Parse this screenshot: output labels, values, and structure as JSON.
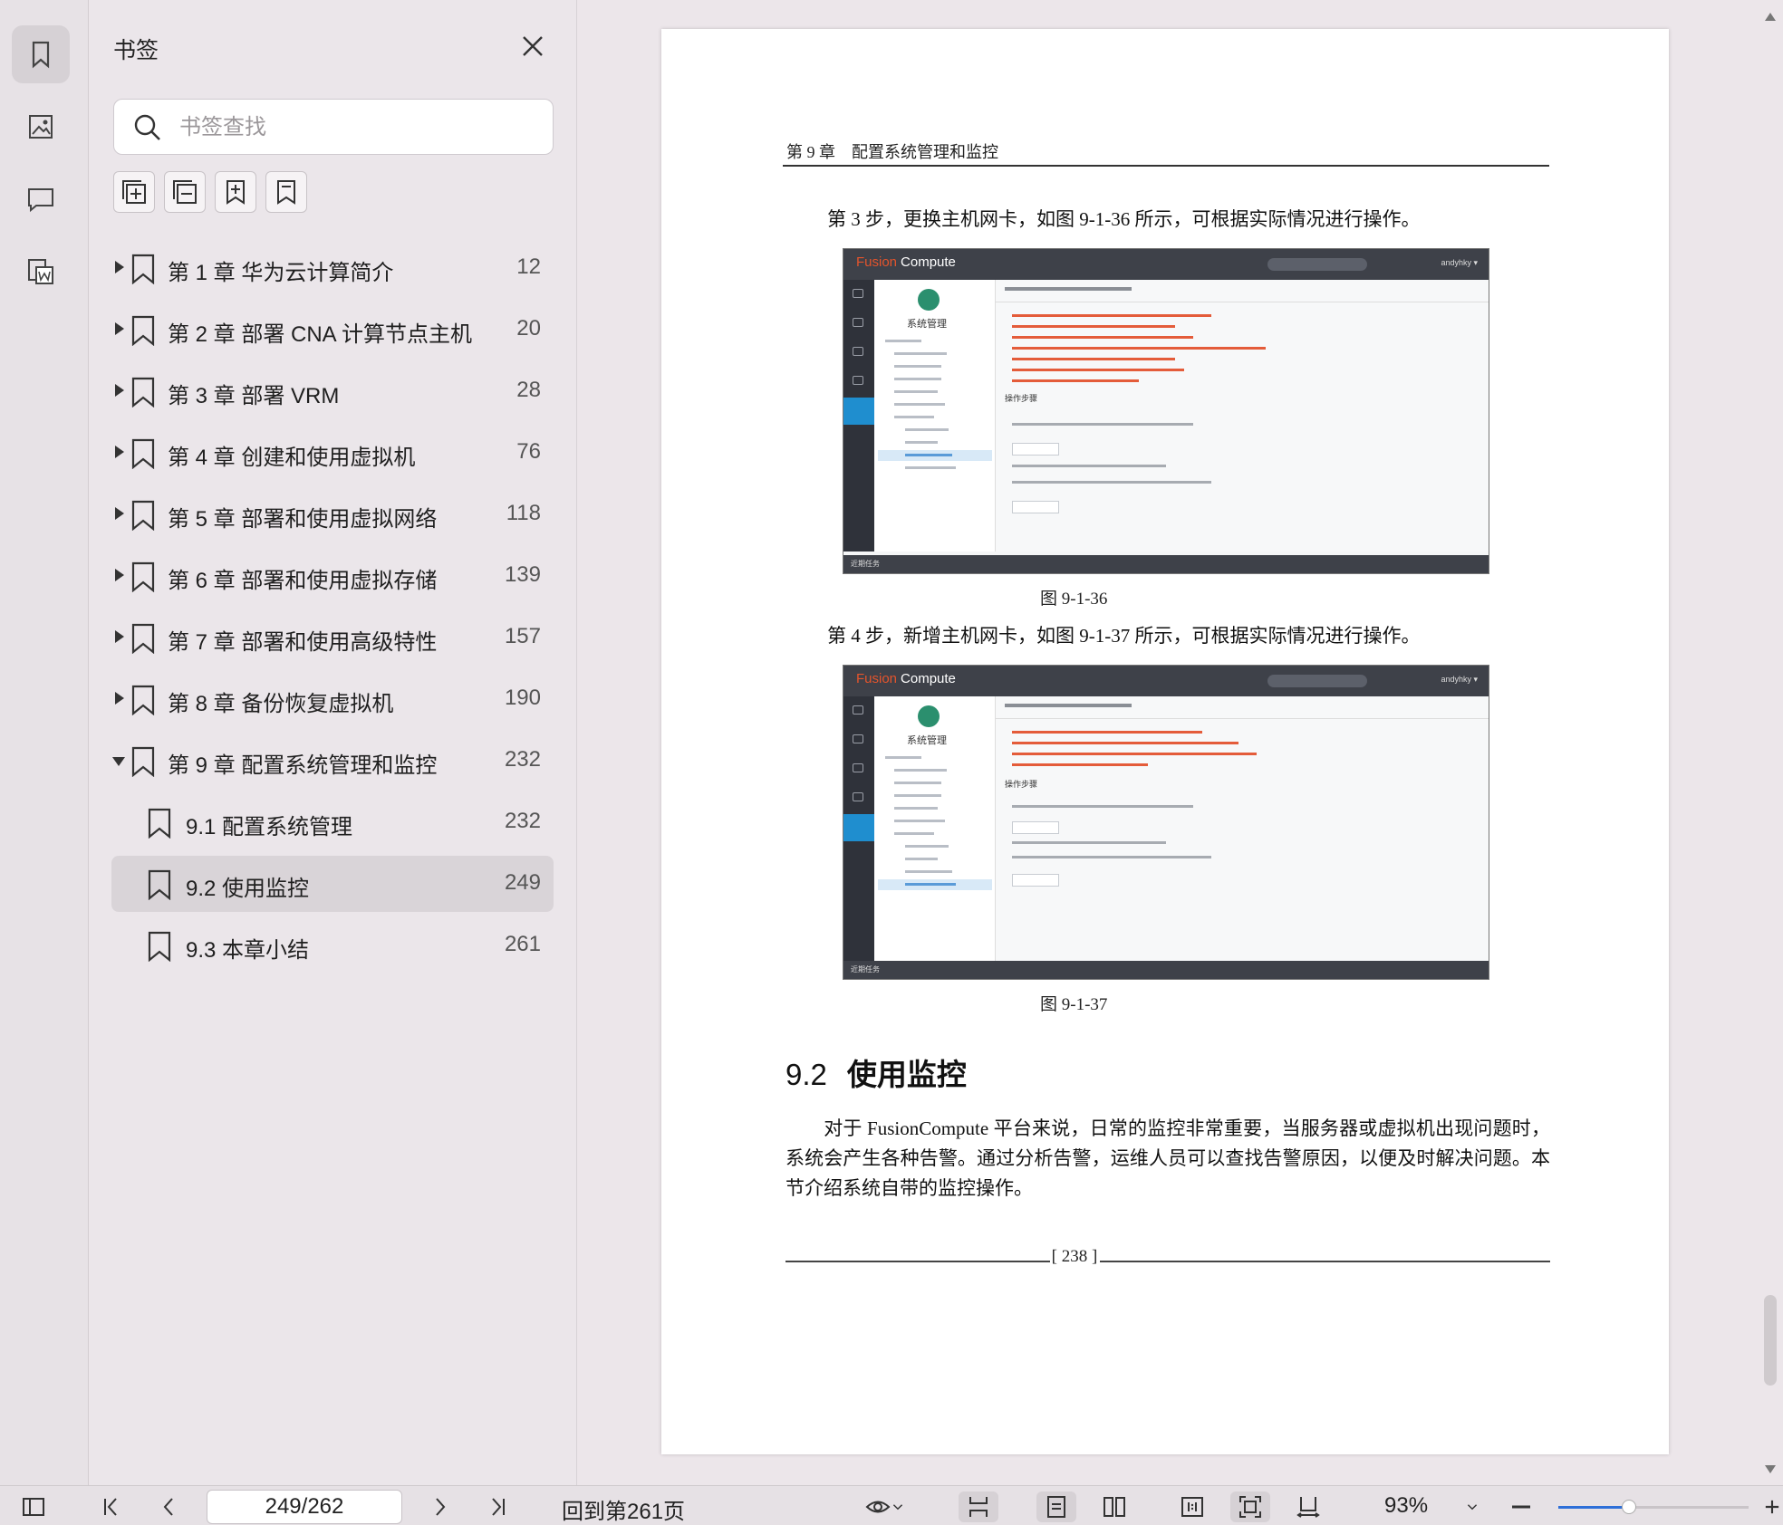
{
  "sidebar_rail": {
    "items": [
      {
        "icon": "bookmark-icon",
        "active": true
      },
      {
        "icon": "image-icon",
        "active": false
      },
      {
        "icon": "comment-icon",
        "active": false
      },
      {
        "icon": "word-export-icon",
        "active": false
      }
    ]
  },
  "bookmarks_panel": {
    "title": "书签",
    "search_placeholder": "书签查找",
    "toolbar": [
      "expand-all-icon",
      "collapse-all-icon",
      "add-bookmark-icon",
      "bookmark-icon"
    ],
    "items": [
      {
        "label": "第 1 章 华为云计算简介",
        "page": "12",
        "level": 0,
        "expanded": false
      },
      {
        "label": "第 2 章 部署 CNA 计算节点主机",
        "page": "20",
        "level": 0,
        "expanded": false
      },
      {
        "label": "第 3 章 部署 VRM",
        "page": "28",
        "level": 0,
        "expanded": false
      },
      {
        "label": "第 4 章 创建和使用虚拟机",
        "page": "76",
        "level": 0,
        "expanded": false
      },
      {
        "label": "第 5 章 部署和使用虚拟网络",
        "page": "118",
        "level": 0,
        "expanded": false
      },
      {
        "label": "第 6 章 部署和使用虚拟存储",
        "page": "139",
        "level": 0,
        "expanded": false
      },
      {
        "label": "第 7 章 部署和使用高级特性",
        "page": "157",
        "level": 0,
        "expanded": false
      },
      {
        "label": "第 8 章 备份恢复虚拟机",
        "page": "190",
        "level": 0,
        "expanded": false
      },
      {
        "label": "第 9 章 配置系统管理和监控",
        "page": "232",
        "level": 0,
        "expanded": true
      },
      {
        "label": "9.1 配置系统管理",
        "page": "232",
        "level": 1,
        "expanded": false
      },
      {
        "label": "9.2 使用监控",
        "page": "249",
        "level": 1,
        "selected": true
      },
      {
        "label": "9.3 本章小结",
        "page": "261",
        "level": 1,
        "expanded": false
      }
    ]
  },
  "document": {
    "running_head": "第 9 章　配置系统管理和监控",
    "step3": "第 3 步，更换主机网卡，如图 9-1-36 所示，可根据实际情况进行操作。",
    "fig1_caption": "图 9-1-36",
    "step4": "第 4 步，新增主机网卡，如图 9-1-37 所示，可根据实际情况进行操作。",
    "fig2_caption": "图 9-1-37",
    "figure_app": {
      "logo_brand": "Fusion",
      "logo_product": "Compute",
      "user": "andyhky ▾",
      "nav_title": "系统管理",
      "steps_title": "操作步骤",
      "footer": "近期任务"
    },
    "section_number": "9.2",
    "section_title": "使用监控",
    "body": "对于 FusionCompute 平台来说，日常的监控非常重要，当服务器或虚拟机出现问题时，系统会产生各种告警。通过分析告警，运维人员可以查找告警原因，以便及时解决问题。本节介绍系统自带的监控操作。",
    "page_number": "238"
  },
  "bottom_toolbar": {
    "page_field": "249/262",
    "back_to": "回到第261页",
    "zoom": "93%",
    "zoom_level": 0.37
  }
}
